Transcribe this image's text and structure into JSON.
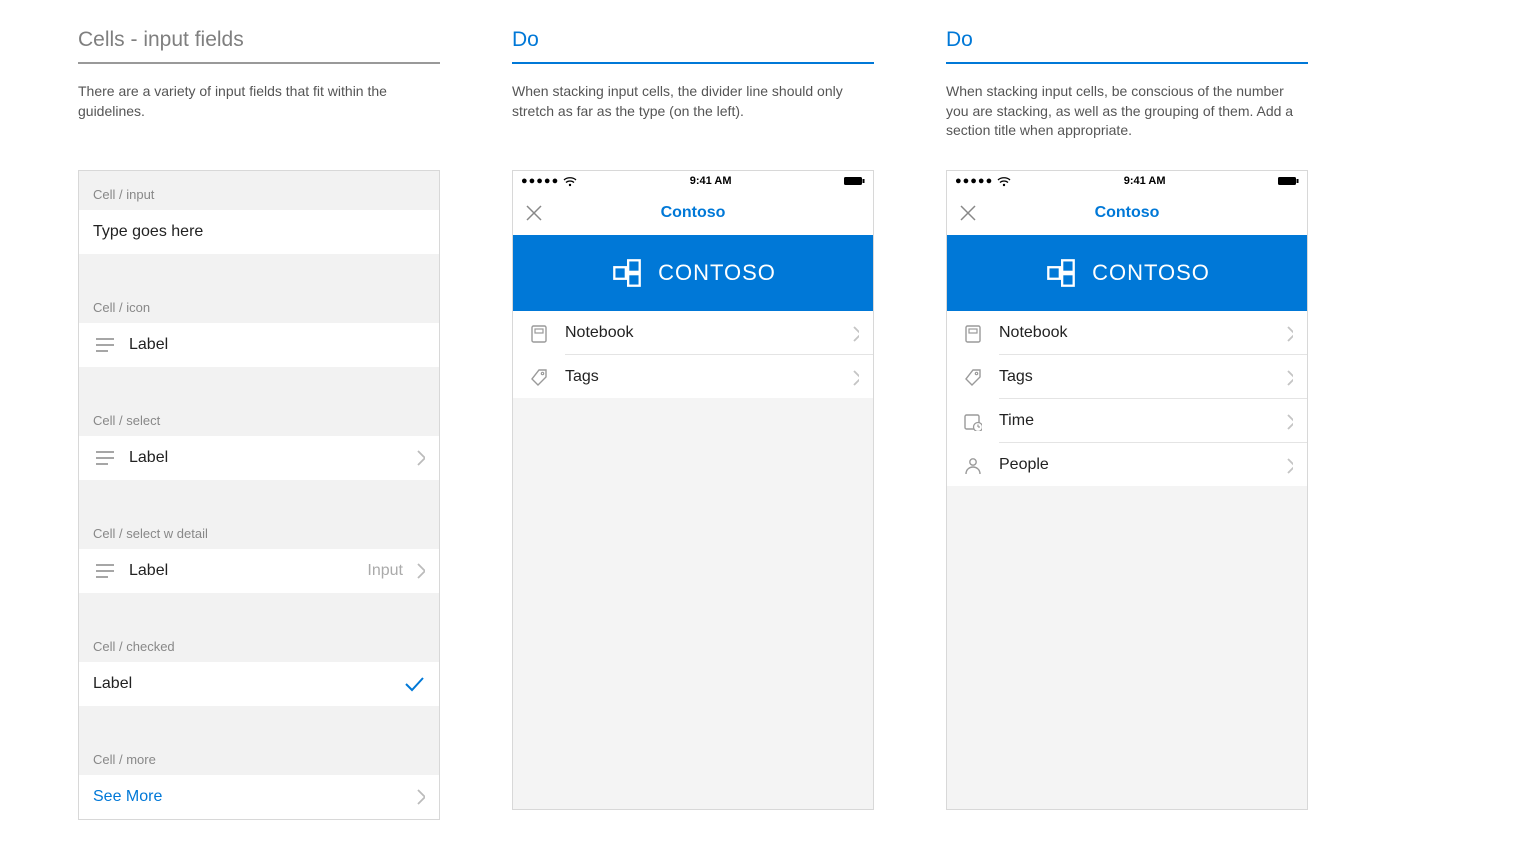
{
  "colors": {
    "accent": "#0078d7"
  },
  "col1": {
    "title": "Cells - input fields",
    "desc": "There are a variety of input fields that fit within the guidelines.",
    "sections": {
      "input_hdr": "Cell / input",
      "input_val": "Type goes here",
      "icon_hdr": "Cell / icon",
      "icon_lbl": "Label",
      "select_hdr": "Cell / select",
      "select_lbl": "Label",
      "selectd_hdr": "Cell / select w detail",
      "selectd_lbl": "Label",
      "selectd_detail": "Input",
      "checked_hdr": "Cell / checked",
      "checked_lbl": "Label",
      "more_hdr": "Cell / more",
      "more_lbl": "See More"
    }
  },
  "col2": {
    "title": "Do",
    "desc": "When stacking input cells, the divider line should only stretch as far as the type (on the left).",
    "status_time": "9:41 AM",
    "nav_title": "Contoso",
    "brand": "CONTOSO",
    "rows": [
      {
        "icon": "notebook",
        "label": "Notebook"
      },
      {
        "icon": "tag",
        "label": "Tags"
      }
    ]
  },
  "col3": {
    "title": "Do",
    "desc": "When stacking input cells, be conscious of the number you are stacking, as well as the grouping of them. Add a section title when appropriate.",
    "status_time": "9:41 AM",
    "nav_title": "Contoso",
    "brand": "CONTOSO",
    "rows": [
      {
        "icon": "notebook",
        "label": "Notebook"
      },
      {
        "icon": "tag",
        "label": "Tags"
      },
      {
        "icon": "time",
        "label": "Time"
      },
      {
        "icon": "people",
        "label": "People"
      }
    ]
  }
}
